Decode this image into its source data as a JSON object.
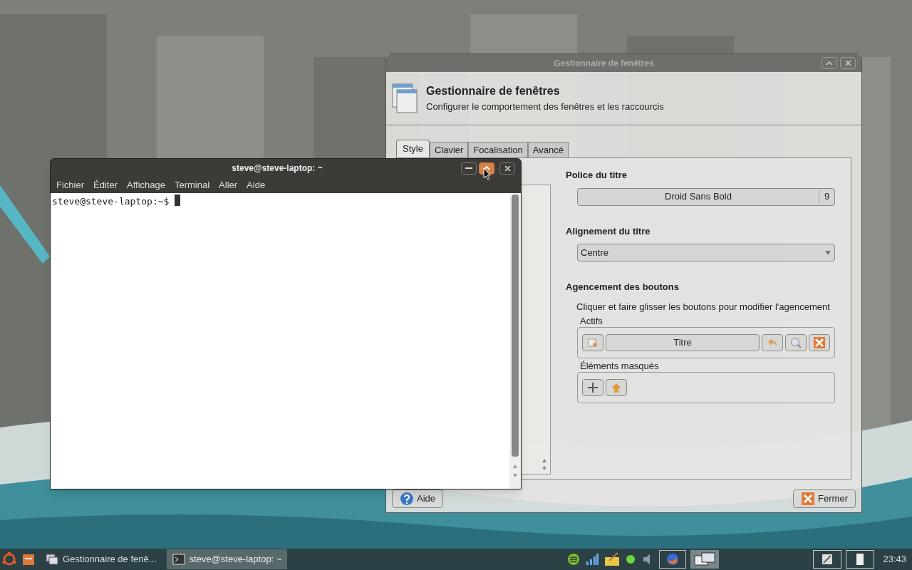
{
  "settings_window": {
    "title": "Gestionnaire de fenêtres",
    "header": {
      "title": "Gestionnaire de fenêtres",
      "subtitle": "Configurer le comportement des fenêtres et les raccourcis"
    },
    "tabs": [
      {
        "label": "Style",
        "selected": true
      },
      {
        "label": "Clavier",
        "selected": false
      },
      {
        "label": "Focalisation",
        "selected": false
      },
      {
        "label": "Avancé",
        "selected": false
      }
    ],
    "title_font": {
      "label": "Police du titre",
      "font": "Droid Sans Bold",
      "size": "9"
    },
    "title_alignment": {
      "label": "Alignement du titre",
      "value": "Centre"
    },
    "button_layout": {
      "heading": "Agencement des boutons",
      "hint": "Cliquer et faire glisser les boutons pour modifier l'agencement",
      "active_label": "Actifs",
      "active_buttons": [
        {
          "kind": "menu"
        },
        {
          "kind": "title",
          "label": "Titre"
        },
        {
          "kind": "shade"
        },
        {
          "kind": "stick"
        },
        {
          "kind": "close"
        }
      ],
      "hidden_label": "Éléments masqués",
      "hidden_buttons": [
        {
          "kind": "maximize"
        },
        {
          "kind": "hide"
        }
      ]
    },
    "footer_buttons": [
      {
        "kind": "help",
        "label": "Aide"
      },
      {
        "kind": "close",
        "label": "Fermer"
      }
    ]
  },
  "terminal": {
    "title": "steve@steve-laptop: ~",
    "menus": [
      "Fichier",
      "Éditer",
      "Affichage",
      "Terminal",
      "Aller",
      "Aide"
    ],
    "prompt": "steve@steve-laptop:~$"
  },
  "taskbar": {
    "tasks": [
      {
        "label": "Gestionnaire de fenê...",
        "selected": false
      },
      {
        "label": "steve@steve-laptop: ~",
        "selected": true
      }
    ],
    "clock": "23:43"
  }
}
